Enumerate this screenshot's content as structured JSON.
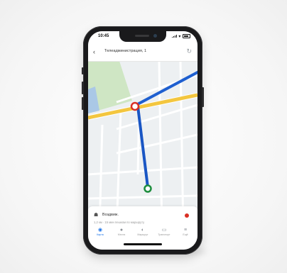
{
  "status_bar": {
    "time": "10:45"
  },
  "header": {
    "title": "Телеадминистрация, 1",
    "back_icon": "back-arrow-icon",
    "refresh_icon": "refresh-icon"
  },
  "map": {
    "colors": {
      "route_primary": "#1a56c4",
      "route_secondary": "#1e5fd0",
      "highway": "#f3c63f",
      "park": "#cfe6c4",
      "water": "#aac8e6",
      "waypoint_start": "#d93025",
      "waypoint_end": "#1e8e3e"
    }
  },
  "card": {
    "destination": "Воздвиж.",
    "subtitle": "1,2 км · 15 мин пешком по маршруту",
    "status_color": "#d93025"
  },
  "tabs": [
    {
      "label": "Карта",
      "icon": "map-pin-icon"
    },
    {
      "label": "Места",
      "icon": "places-icon"
    },
    {
      "label": "Маршрут",
      "icon": "route-icon"
    },
    {
      "label": "Транспорт",
      "icon": "bus-icon"
    },
    {
      "label": "Ещё",
      "icon": "menu-icon"
    }
  ]
}
